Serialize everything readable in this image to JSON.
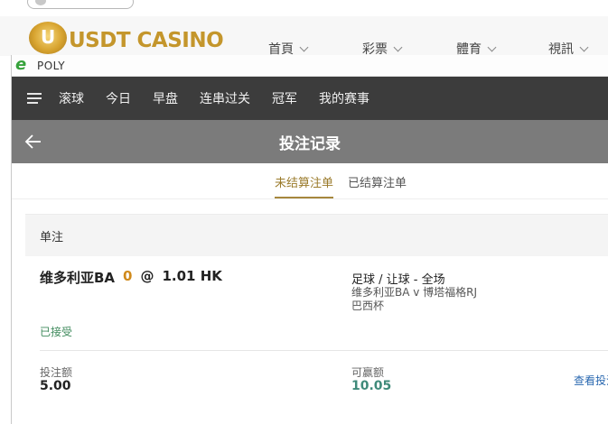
{
  "background_site": {
    "logo_letter": "U",
    "logo_text": "USDT CASINO",
    "nav": [
      "首頁",
      "彩票",
      "體育",
      "視訊"
    ]
  },
  "popup": {
    "title": "POLY",
    "menu": {
      "items": [
        "滚球",
        "今日",
        "早盘",
        "连串过关",
        "冠军",
        "我的赛事"
      ]
    },
    "header": {
      "title": "投注记录"
    },
    "tabs": [
      {
        "label": "未结算注单",
        "active": true
      },
      {
        "label": "已结算注单",
        "active": false
      }
    ],
    "section_label": "单注",
    "bet": {
      "team": "维多利亚BA",
      "score": "0",
      "at": "@",
      "odds": "1.01 HK",
      "market": "足球 / 让球 - 全场",
      "match": "维多利亚BA v 博塔福格RJ",
      "league": "巴西杯",
      "status": "已接受",
      "stake_label": "投注额",
      "stake_value": "5.00",
      "win_label": "可赢额",
      "win_value": "10.05",
      "view_link": "查看投注"
    }
  },
  "colors": {
    "menubar": "#3c3c3c",
    "header": "#7b7b7b",
    "accent_gold": "#a6873d",
    "accepted_green": "#3f8a5c",
    "win_teal": "#3f8a7a",
    "score_orange": "#d08a1c"
  },
  "icons": [
    "ie-browser-icon",
    "hamburger-menu-icon",
    "back-arrow-icon",
    "chevron-down-icon"
  ]
}
